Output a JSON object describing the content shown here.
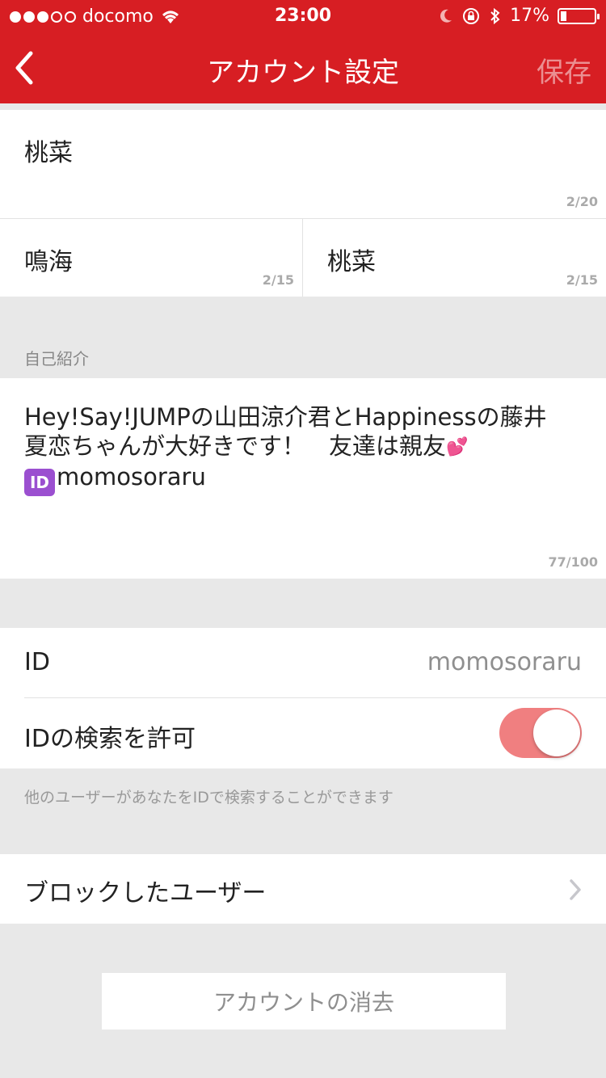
{
  "status_bar": {
    "carrier": "docomo",
    "time": "23:00",
    "battery_percent": "17%",
    "battery_level": 0.17,
    "icons": [
      "signal-dots",
      "wifi-icon",
      "moon-icon",
      "rotation-lock-icon",
      "bluetooth-icon",
      "battery-icon"
    ]
  },
  "nav": {
    "title": "アカウント設定",
    "save_label": "保存",
    "back_icon": "chevron-left-icon"
  },
  "profile": {
    "nickname": {
      "value": "桃菜",
      "counter": "2/20"
    },
    "last_name": {
      "value": "鳴海",
      "counter": "2/15"
    },
    "first_name": {
      "value": "桃菜",
      "counter": "2/15"
    }
  },
  "bio": {
    "label": "自己紹介",
    "text_line1": "Hey!Say!JUMPの山田涼介君とHappinessの藤井",
    "text_line2": "夏恋ちゃんが大好きです！　友達は親友",
    "hearts": "💕",
    "id_badge": "ID",
    "text_line3": "momosoraru",
    "counter": "77/100"
  },
  "id_section": {
    "id_label": "ID",
    "id_value": "momosoraru",
    "search_label": "IDの検索を許可",
    "search_enabled": true,
    "toggle_color": "#f07f80",
    "note": "他のユーザーがあなたをIDで検索することができます"
  },
  "blocked": {
    "label": "ブロックしたユーザー",
    "chevron_icon": "chevron-right-icon"
  },
  "delete": {
    "label": "アカウントの消去"
  },
  "colors": {
    "brand_red": "#d71e23",
    "background": "#e8e8e8"
  }
}
